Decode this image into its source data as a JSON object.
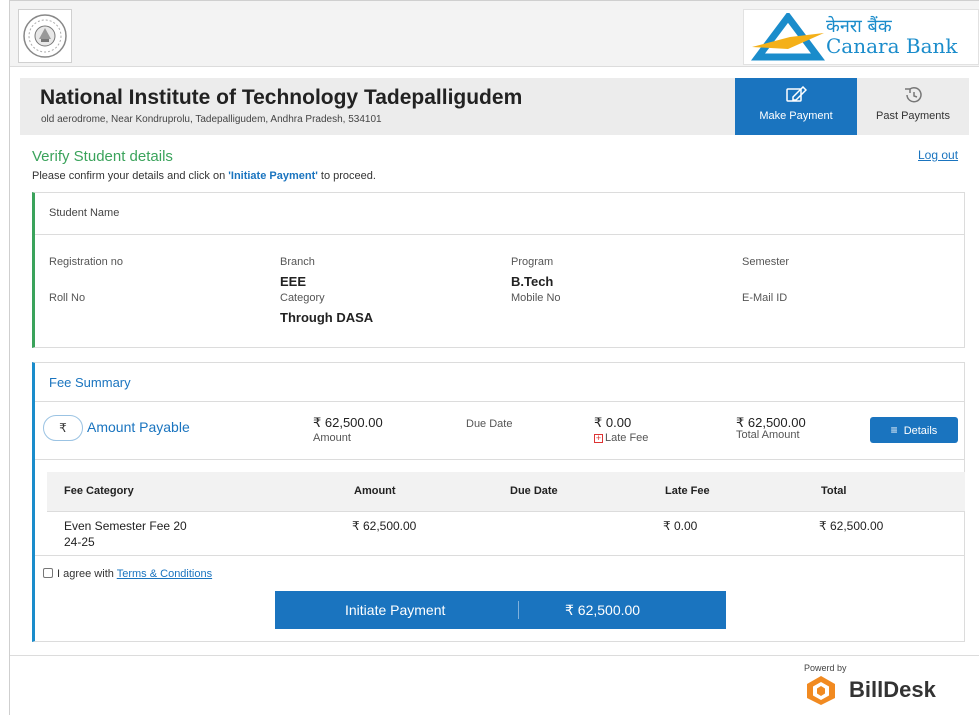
{
  "bank": {
    "name_hindi": "केनरा बैंक",
    "name_english": "Canara Bank",
    "brand_color": "#1a8ccb"
  },
  "institute": {
    "name": "National Institute of Technology Tadepalligudem",
    "address": "old aerodrome, Near Kondruprolu, Tadepalligudem, Andhra Pradesh, 534101"
  },
  "tabs": {
    "make_payment": "Make Payment",
    "past_payments": "Past Payments"
  },
  "verify": {
    "title": "Verify Student details",
    "logout": "Log out",
    "confirm_prefix": "Please confirm your details and click on ",
    "confirm_link": "'Initiate Payment'",
    "confirm_suffix": " to proceed."
  },
  "student": {
    "name_label": "Student Name",
    "reg_label": "Registration no",
    "branch_label": "Branch",
    "branch_value": "EEE",
    "program_label": "Program",
    "program_value": "B.Tech",
    "semester_label": "Semester",
    "roll_label": "Roll No",
    "category_label": "Category",
    "category_value": "Through DASA",
    "mobile_label": "Mobile No",
    "email_label": "E-Mail ID"
  },
  "fee_summary": {
    "title": "Fee Summary",
    "rupee_icon": "₹",
    "amount_payable_label": "Amount Payable",
    "amount": "₹ 62,500.00",
    "amount_label": "Amount",
    "due_date_label": "Due Date",
    "late_fee": "₹ 0.00",
    "late_fee_label": "Late Fee",
    "total": "₹ 62,500.00",
    "total_label": "Total Amount",
    "details_button": "Details"
  },
  "fee_table": {
    "headers": [
      "Fee Category",
      "Amount",
      "Due Date",
      "Late Fee",
      "Total"
    ],
    "rows": [
      {
        "category_line1": "Even Semester Fee 20",
        "category_line2": "24-25",
        "amount": "₹ 62,500.00",
        "due_date": "",
        "late_fee": "₹ 0.00",
        "total": "₹ 62,500.00"
      }
    ]
  },
  "agree": {
    "prefix": "I agree with ",
    "link": "Terms & Conditions"
  },
  "pay_button": {
    "label": "Initiate Payment",
    "amount": "₹ 62,500.00"
  },
  "footer": {
    "powered_by": "Powerd by",
    "brand": "BillDesk"
  }
}
